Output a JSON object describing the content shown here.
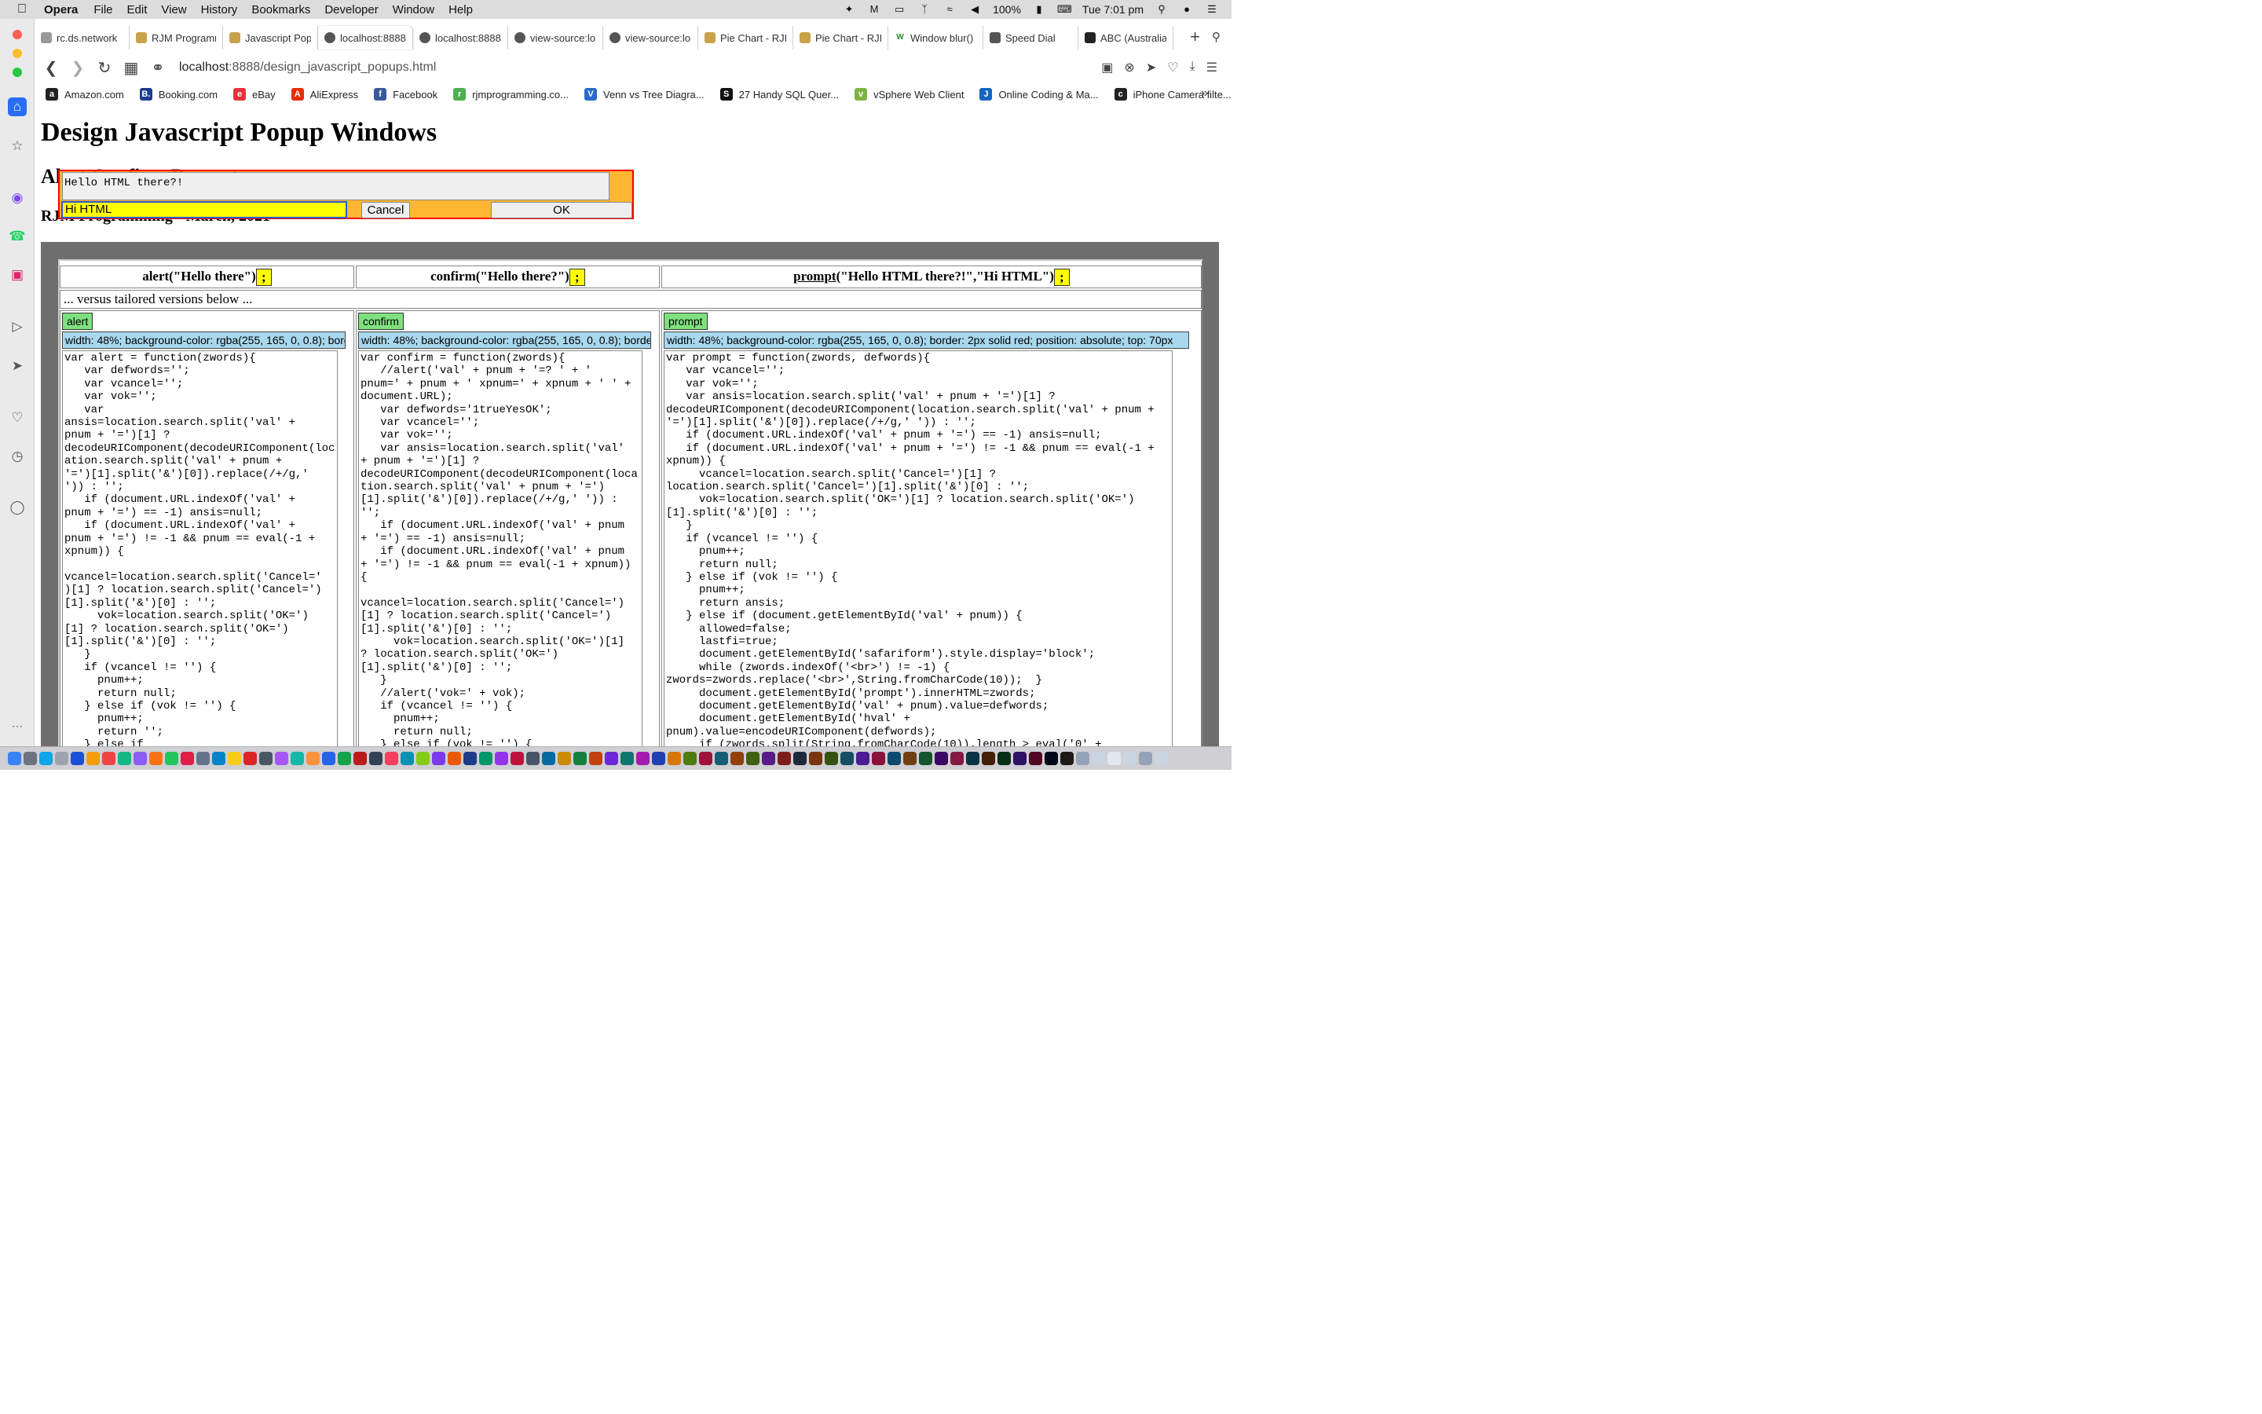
{
  "menubar": {
    "app": "Opera",
    "items": [
      "File",
      "Edit",
      "View",
      "History",
      "Bookmarks",
      "Developer",
      "Window",
      "Help"
    ],
    "battery": "100%",
    "clock": "Tue 7:01 pm"
  },
  "tabs": [
    {
      "label": "rc.ds.network",
      "icon": "page-icon"
    },
    {
      "label": "RJM Programm",
      "icon": "rjm-icon"
    },
    {
      "label": "Javascript Pop",
      "icon": "rjm-icon"
    },
    {
      "label": "localhost:8888",
      "icon": "github-icon",
      "active": true
    },
    {
      "label": "localhost:8888",
      "icon": "github-icon"
    },
    {
      "label": "view-source:lo",
      "icon": "github-icon"
    },
    {
      "label": "view-source:lo",
      "icon": "github-icon"
    },
    {
      "label": "Pie Chart - RJI",
      "icon": "rjm-icon"
    },
    {
      "label": "Pie Chart - RJI",
      "icon": "rjm-icon"
    },
    {
      "label": "Window blur()",
      "icon": "w3-icon"
    },
    {
      "label": "Speed Dial",
      "icon": "grid-icon"
    },
    {
      "label": "ABC (Australia",
      "icon": "abc-icon"
    }
  ],
  "address": {
    "host": "localhost",
    "rest": ":8888/design_javascript_popups.html"
  },
  "bookmarks": [
    {
      "label": "Amazon.com",
      "icon": "amazon-icon",
      "color": "#222222",
      "glyph": "a"
    },
    {
      "label": "Booking.com",
      "icon": "booking-icon",
      "color": "#1b3d8f",
      "glyph": "B."
    },
    {
      "label": "eBay",
      "icon": "ebay-icon",
      "color": "#e53238",
      "glyph": "e"
    },
    {
      "label": "AliExpress",
      "icon": "aliexpress-icon",
      "color": "#e62e04",
      "glyph": "A"
    },
    {
      "label": "Facebook",
      "icon": "facebook-icon",
      "color": "#3b5998",
      "glyph": "f"
    },
    {
      "label": "rjmprogramming.co...",
      "icon": "rjm-icon",
      "color": "#4caf50",
      "glyph": "r"
    },
    {
      "label": "Venn vs Tree Diagra...",
      "icon": "venn-icon",
      "color": "#2a6acb",
      "glyph": "V"
    },
    {
      "label": "27 Handy SQL Quer...",
      "icon": "sql-icon",
      "color": "#111111",
      "glyph": "S"
    },
    {
      "label": "vSphere Web Client",
      "icon": "vsphere-icon",
      "color": "#7cb342",
      "glyph": "v"
    },
    {
      "label": "Online Coding & Ma...",
      "icon": "coding-icon",
      "color": "#1565c0",
      "glyph": "J"
    },
    {
      "label": "iPhone Camera filte...",
      "icon": "camera-icon",
      "color": "#222222",
      "glyph": "c"
    }
  ],
  "page": {
    "h1": "Design Javascript Popup Windows",
    "h2": "Alert Confirm Prompt",
    "h3": "RJM Programming - March, 2021"
  },
  "popup": {
    "message": "Hello HTML there?!",
    "input_value": "Hi HTML",
    "cancel_label": "Cancel",
    "ok_label": "OK"
  },
  "table": {
    "headers": [
      {
        "prefix": "",
        "text": "alert(\"Hello there\")",
        "semi": ";"
      },
      {
        "prefix": "",
        "text": "confirm(\"Hello there?\")",
        "semi": ";"
      },
      {
        "prefix": "prompt",
        "text": "(\"Hello HTML there?!\",\"Hi HTML\")",
        "semi": ";"
      }
    ],
    "versus": "... versus tailored versions below ...",
    "columns": [
      {
        "button": "alert",
        "style": "width: 48%; background-color: rgba(255, 165, 0, 0.8); border: 2px solid red; position: absolute; top: 70px",
        "code": "var alert = function(zwords){\n   var defwords='';\n   var vcancel='';\n   var vok='';\n   var\nansis=location.search.split('val' +\npnum + '=')[1] ?\ndecodeURIComponent(decodeURIComponent(location.search.split('val' + pnum +\n'=')[1].split('&')[0]).replace(/+/g,'\n')) : '';\n   if (document.URL.indexOf('val' +\npnum + '=') == -1) ansis=null;\n   if (document.URL.indexOf('val' +\npnum + '=') != -1 && pnum == eval(-1 +\nxpnum)) {\n\nvcancel=location.search.split('Cancel='\n)[1] ? location.search.split('Cancel=')\n[1].split('&')[0] : '';\n     vok=location.search.split('OK=')\n[1] ? location.search.split('OK=')\n[1].split('&')[0] : '';\n   }\n   if (vcancel != '') {\n     pnum++;\n     return null;\n   } else if (vok != '') {\n     pnum++;\n     return '';\n   } else if"
      },
      {
        "button": "confirm",
        "style": "width: 48%; background-color: rgba(255, 165, 0, 0.8); border: 2px solid red; position: absolute; top: 70px",
        "code": "var confirm = function(zwords){\n   //alert('val' + pnum + '=? ' + '\npnum=' + pnum + ' xpnum=' + xpnum + ' ' +\ndocument.URL);\n   var defwords='1trueYesOK';\n   var vcancel='';\n   var vok='';\n   var ansis=location.search.split('val'\n+ pnum + '=')[1] ?\ndecodeURIComponent(decodeURIComponent(location.search.split('val' + pnum + '=')\n[1].split('&')[0]).replace(/+/g,' ')) :\n'';\n   if (document.URL.indexOf('val' + pnum\n+ '=') == -1) ansis=null;\n   if (document.URL.indexOf('val' + pnum\n+ '=') != -1 && pnum == eval(-1 + xpnum))\n{\n\nvcancel=location.search.split('Cancel=')\n[1] ? location.search.split('Cancel=')\n[1].split('&')[0] : '';\n     vok=location.search.split('OK=')[1]\n? location.search.split('OK=')\n[1].split('&')[0] : '';\n   }\n   //alert('vok=' + vok);\n   if (vcancel != '') {\n     pnum++;\n     return null;\n   } else if (vok != '') {"
      },
      {
        "button": "prompt",
        "style": "width: 48%; background-color: rgba(255, 165, 0, 0.8); border: 2px solid red; position: absolute; top: 70px",
        "code": "var prompt = function(zwords, defwords){\n   var vcancel='';\n   var vok='';\n   var ansis=location.search.split('val' + pnum + '=')[1] ?\ndecodeURIComponent(decodeURIComponent(location.search.split('val' + pnum +\n'=')[1].split('&')[0]).replace(/+/g,' ')) : '';\n   if (document.URL.indexOf('val' + pnum + '=') == -1) ansis=null;\n   if (document.URL.indexOf('val' + pnum + '=') != -1 && pnum == eval(-1 +\nxpnum)) {\n     vcancel=location.search.split('Cancel=')[1] ?\nlocation.search.split('Cancel=')[1].split('&')[0] : '';\n     vok=location.search.split('OK=')[1] ? location.search.split('OK=')\n[1].split('&')[0] : '';\n   }\n   if (vcancel != '') {\n     pnum++;\n     return null;\n   } else if (vok != '') {\n     pnum++;\n     return ansis;\n   } else if (document.getElementById('val' + pnum)) {\n     allowed=false;\n     lastfi=true;\n     document.getElementById('safariform').style.display='block';\n     while (zwords.indexOf('<br>') != -1) {\nzwords=zwords.replace('<br>',String.fromCharCode(10));  }\n     document.getElementById('prompt').innerHTML=zwords;\n     document.getElementById('val' + pnum).value=defwords;\n     document.getElementById('hval' +\npnum).value=encodeURIComponent(defwords);\n     if (zwords.split(String.fromCharCode(10)).length > eval('0' +"
      }
    ]
  }
}
